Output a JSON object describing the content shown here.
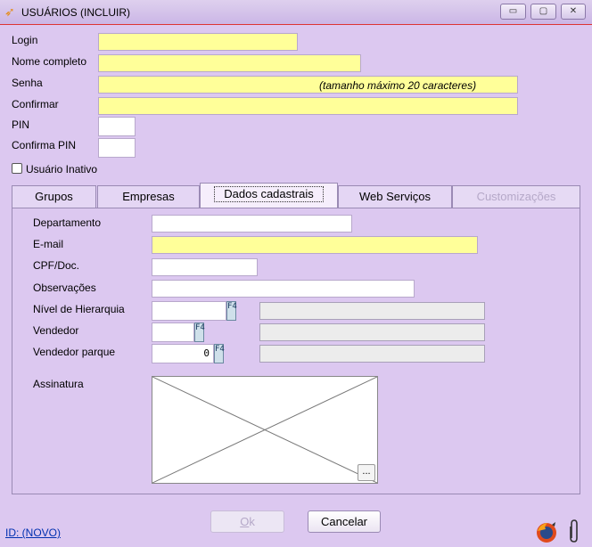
{
  "window": {
    "title": "USUÁRIOS (INCLUIR)",
    "controls": {
      "minimize": "▭",
      "maximize": "▢",
      "close": "✕"
    }
  },
  "form": {
    "login_label": "Login",
    "nome_label": "Nome completo",
    "senha_label": "Senha",
    "senha_hint": "(tamanho máximo 20 caracteres)",
    "confirmar_label": "Confirmar",
    "pin_label": "PIN",
    "confirma_pin_label": "Confirma PIN",
    "inativo_label": "Usuário Inativo"
  },
  "tabs": [
    {
      "label": "Grupos",
      "state": "normal"
    },
    {
      "label": "Empresas",
      "state": "normal"
    },
    {
      "label": "Dados cadastrais",
      "state": "active"
    },
    {
      "label": "Web Serviços",
      "state": "normal"
    },
    {
      "label": "Customizações",
      "state": "disabled"
    }
  ],
  "dados": {
    "departamento_label": "Departamento",
    "email_label": "E-mail",
    "cpf_label": "CPF/Doc.",
    "observacoes_label": "Observações",
    "nivel_label": "Nível de Hierarquia",
    "vendedor_label": "Vendedor",
    "vendedor_parque_label": "Vendedor parque",
    "vendedor_parque_value": "0",
    "assinatura_label": "Assinatura",
    "browse_label": "...",
    "f4_label": "F4"
  },
  "buttons": {
    "ok_accel": "O",
    "ok_rest": "k",
    "cancel": "Cancelar"
  },
  "footer": {
    "id_text": "ID: (NOVO)"
  },
  "colors": {
    "background": "#dcc8f0",
    "required_field": "#ffff99",
    "title_underline": "#dd3333"
  },
  "icons": [
    "app-logo-icon",
    "minimize-icon",
    "maximize-icon",
    "close-icon",
    "f4-lookup-icon",
    "firefox-icon",
    "paperclip-icon"
  ]
}
